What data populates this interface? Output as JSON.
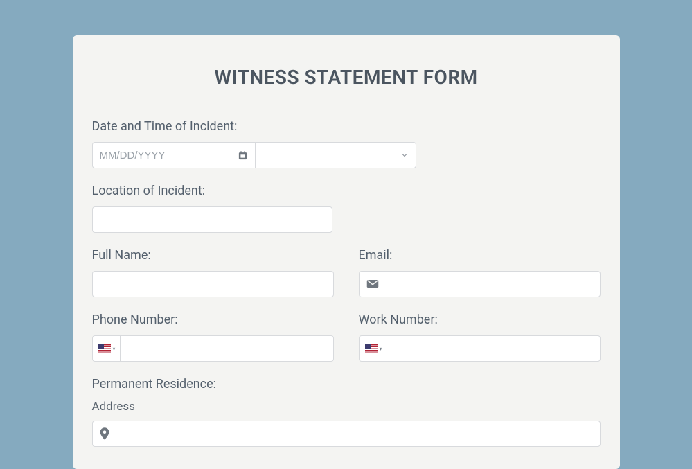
{
  "title": "WITNESS STATEMENT FORM",
  "dateTime": {
    "label": "Date and Time of Incident:",
    "datePlaceholder": "MM/DD/YYYY",
    "dateValue": "",
    "timeValue": ""
  },
  "location": {
    "label": "Location of Incident:",
    "value": ""
  },
  "fullName": {
    "label": "Full Name:",
    "value": ""
  },
  "email": {
    "label": "Email:",
    "value": ""
  },
  "phone": {
    "label": "Phone Number:",
    "value": "",
    "country": "US"
  },
  "workPhone": {
    "label": "Work Number:",
    "value": "",
    "country": "US"
  },
  "residence": {
    "label": "Permanent Residence:",
    "addressLabel": "Address",
    "addressValue": ""
  }
}
